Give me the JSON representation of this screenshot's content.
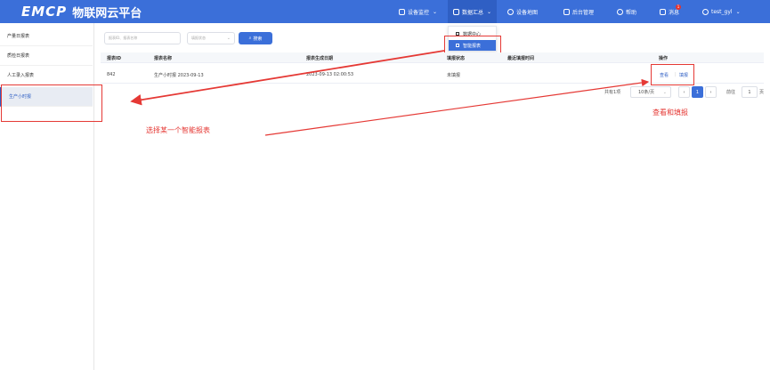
{
  "header": {
    "logo_mark": "EMCP",
    "logo_text": "物联网云平台",
    "nav": [
      {
        "label": "设备监控",
        "has_chevron": true
      },
      {
        "label": "数据汇总",
        "has_chevron": true
      },
      {
        "label": "设备地图"
      },
      {
        "label": "后台管理"
      },
      {
        "label": "帮助"
      },
      {
        "label": "消息",
        "badge": "1"
      },
      {
        "label": "test_gyl",
        "has_chevron": true
      }
    ]
  },
  "dropdown": {
    "items": [
      {
        "label": "数据中心",
        "active": false
      },
      {
        "label": "智能报表",
        "active": true
      }
    ]
  },
  "sidebar": {
    "items": [
      {
        "label": "产量日报表"
      },
      {
        "label": "质检日报表"
      },
      {
        "label": "人工录入报表"
      },
      {
        "label": "生产小时报",
        "active": true
      }
    ]
  },
  "filters": {
    "search_placeholder": "报表ID、报表名称",
    "status_placeholder": "填报状态",
    "search_button": "搜索"
  },
  "table": {
    "columns": [
      "报表ID",
      "报表名称",
      "报表生成日期",
      "填报状态",
      "最近填报时间",
      "操作"
    ],
    "rows": [
      {
        "id": "842",
        "name": "生产小时报 2023-09-13",
        "generated": "2023-09-13 02:00:53",
        "status": "未填报",
        "last_fill": "",
        "actions": [
          "查看",
          "填报"
        ]
      }
    ]
  },
  "pagination": {
    "total": "共有1项",
    "page_size": "10条/页",
    "current_page": "1",
    "goto_label": "前往",
    "goto_value": "1",
    "page_suffix": "页"
  },
  "annotations": {
    "select_report": "选择某一个智能报表",
    "view_and_fill": "查看和填报"
  },
  "colors": {
    "brand": "#3b6fd9",
    "annotation": "#e53935"
  }
}
